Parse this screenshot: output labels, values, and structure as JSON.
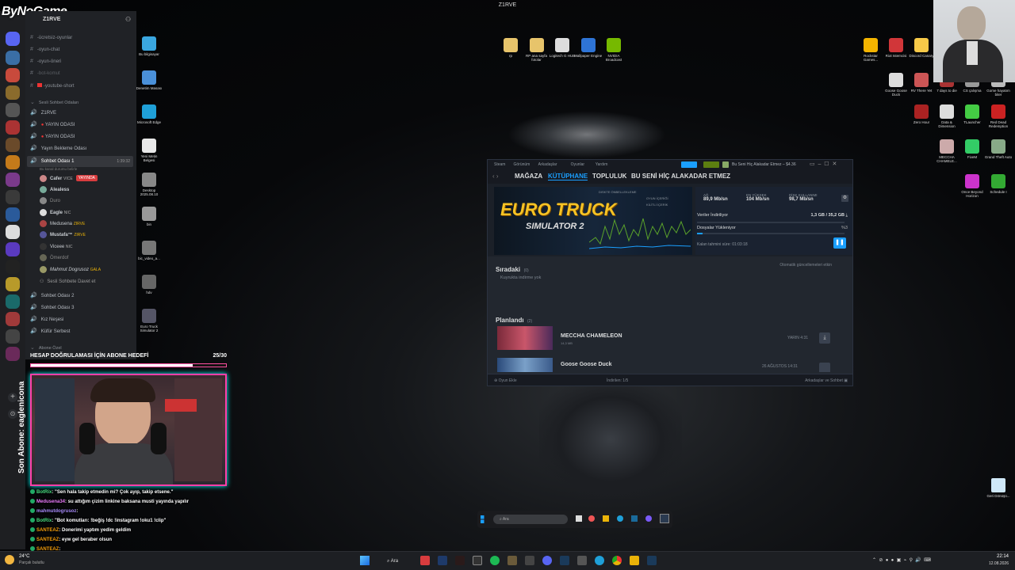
{
  "window": {
    "title": "Z1RVE"
  },
  "brand": {
    "logo": "ByNoGame"
  },
  "discord": {
    "server_name": "Z1RVE",
    "text_channels": [
      "-ücretsiz-oyunlar",
      "-oyun-chat",
      "-oyun-öneri",
      "-bot-komut",
      "-youtube-short"
    ],
    "voice_category": "Sesli Sohbet Odaları",
    "voice_channels": [
      "Z1RVE",
      "YAYIN ODASI",
      "YAYIN ODASI",
      "Yayın Bekleme Odası",
      "Sohbet Odası 1"
    ],
    "voice_topic": "Bu kanal durumu belirle",
    "voice_time": "1:39:32",
    "members": [
      {
        "name": "Cafer",
        "tag": "VICE",
        "live": "YAYINDA"
      },
      {
        "name": "Alealess",
        "tag": "",
        "live": ""
      },
      {
        "name": "Duro",
        "tag": "",
        "live": ""
      },
      {
        "name": "Eagle",
        "tag": "NIC",
        "live": ""
      },
      {
        "name": "Medusena",
        "tag": "ZIRVE",
        "live": ""
      },
      {
        "name": "Mustafa™",
        "tag": "ZIRVE",
        "live": ""
      },
      {
        "name": "Viceee",
        "tag": "NIC",
        "live": ""
      },
      {
        "name": "Ömerdof",
        "tag": "",
        "live": ""
      },
      {
        "name": "Mahmut Dogrusoz",
        "tag": "GALA",
        "live": ""
      }
    ],
    "invite_label": "Sesli Sohbete Davet et",
    "more_voice": [
      "Sohbet Odası 2",
      "Sohbet Odası 3",
      "Kız Neşesi",
      "Küfür Serbest"
    ],
    "subscriber_category": "Abone Özel",
    "subscriber_room": "Abone Sesli"
  },
  "stream": {
    "goal_label": "HESAP DOĞRULAMASI İÇİN ABONE HEDEFİ",
    "goal_count": "25/30",
    "goal_progress": 0.83,
    "vertical_text": "Son Abone: eaglenicona",
    "chat": [
      {
        "user": "BotRix",
        "text": ": \"Sen hala takip etmedin mi? Çok ayıp, takip etsene.\"",
        "color": "#4ade80"
      },
      {
        "user": "Medusena34",
        "text": ": su attığım çizim linkine baksana musti yayında yapılır",
        "color": "#e879f9"
      },
      {
        "user": "mahmutdogrusoz",
        "text": ":",
        "color": "#a78bfa"
      },
      {
        "user": "BotRix",
        "text": ": \"Bot komutları: !beğiş !dc !instagram !oku1 !clip\"",
        "color": "#4ade80"
      },
      {
        "user": "SANTEAZ",
        "text": ": Donerimi yaptım yedim geldim",
        "color": "#f59e0b"
      },
      {
        "user": "SANTEAZ",
        "text": ": eyw gel beraber olsun",
        "color": "#f59e0b"
      },
      {
        "user": "SANTEAZ",
        "text": ":",
        "color": "#f59e0b"
      },
      {
        "user": "SANTEAZ",
        "text": ": onun saati geçti",
        "color": "#f59e0b"
      }
    ]
  },
  "desktop_left": [
    {
      "label": "Bu bilgisayar",
      "color": "#3aa7e0"
    },
    {
      "label": "Denetim Masası",
      "color": "#4a90d9"
    },
    {
      "label": "Microsoft Edge",
      "color": "#1fa0d8"
    },
    {
      "label": "Yeni Metin Belgesi",
      "color": "#e8e8e8"
    },
    {
      "label": "Desktop 2025.08.10",
      "color": "#888"
    },
    {
      "label": "bin",
      "color": "#999"
    },
    {
      "label": "bic_video_a...",
      "color": "#777"
    },
    {
      "label": "hdv",
      "color": "#666"
    },
    {
      "label": "Euro Truck Simulator 2",
      "color": "#556"
    }
  ],
  "desktop_top": [
    {
      "label": "rp",
      "color": "#e7c46b"
    },
    {
      "label": "RP ana sayfa fotolar",
      "color": "#e7c46b"
    },
    {
      "label": "Logitech G HUB",
      "color": "#ddd"
    },
    {
      "label": "Wallpaper Engine",
      "color": "#2e74d6"
    },
    {
      "label": "NVIDIA Broadcast",
      "color": "#76b900"
    }
  ],
  "desktop_right": [
    {
      "label": "Rockstar Games...",
      "color": "#f4b400"
    },
    {
      "label": "Riot Istemcisi",
      "color": "#d13639"
    },
    {
      "label": "Discord Canary",
      "color": "#f7c948"
    },
    {
      "label": "Goose Goose Duck",
      "color": "#ddd"
    },
    {
      "label": "RV There Yet",
      "color": "#c55"
    },
    {
      "label": "7 days to die",
      "color": "#a33"
    },
    {
      "label": "CS çalışma",
      "color": "#999"
    },
    {
      "label": "Gome hayatım biter",
      "color": "#bbb"
    },
    {
      "label": "Zero Hour",
      "color": "#a22"
    },
    {
      "label": "Data & Dimension",
      "color": "#ddd"
    },
    {
      "label": "TLauncher",
      "color": "#4c4"
    },
    {
      "label": "Red Dead Redemption",
      "color": "#c22"
    },
    {
      "label": "MECCHA CHAMELE...",
      "color": "#caa"
    },
    {
      "label": "FiveM",
      "color": "#3c6"
    },
    {
      "label": "Grand Theft Auto",
      "color": "#8a8"
    },
    {
      "label": "Once Beyond Horizon",
      "color": "#c3c"
    },
    {
      "label": "Schedule I",
      "color": "#3a3"
    }
  ],
  "recycle_bin": "Geri Dönüşü...",
  "steam": {
    "menu": [
      "Steam",
      "Görünüm",
      "Arkadaşlar",
      "Oyunlar",
      "Yardım"
    ],
    "nav": [
      "MAĞAZA",
      "KÜTÜPHANE",
      "TOPLULUK",
      "BU SENİ HİÇ ALAKADAR ETMEZ"
    ],
    "user_label": "Bu Seni Hiç Alakadar Etmez",
    "wallet": "$4.36",
    "banner_line1": "EURO TRUCK",
    "banner_line2": "SIMULATOR 2",
    "graph_legend": [
      "DISKTE ÖNBELLEKLEME",
      "OYUN İÇERİĞİ",
      "KİLİTLİ İÇERİK"
    ],
    "stats": [
      {
        "label": "AĞ",
        "value": "89,9 Mb/sn"
      },
      {
        "label": "EN YÜKSEK",
        "value": "104 Mb/sn"
      },
      {
        "label": "DİSK KULLANIMI",
        "value": "98,7 Mb/sn"
      }
    ],
    "downloaded_label": "Veriler İndiriliyor",
    "downloaded_value": "1,3 GB / 35,2 GB",
    "files_label": "Dosyalar Yükleniyor",
    "files_percent": "%3",
    "download_progress": 0.04,
    "time_left": "Kalan tahmini süre: 01:03:18",
    "queue_title": "Sıradaki",
    "queue_count": "(0)",
    "queue_hint": "Otomatik güncellemeleri etkin",
    "queue_empty": "Kuyrukta indirme yok",
    "planned_title": "Planlandı",
    "planned_count": "(2)",
    "planned": [
      {
        "name": "MECCHA CHAMELEON",
        "size": "14,3 MB",
        "when": "YARIN 4:31"
      },
      {
        "name": "Goose Goose Duck",
        "size": "",
        "when": "26 AĞUSTOS 14:31"
      }
    ],
    "footer_left": "Oyun Ekle",
    "footer_mid": "İndirilen: 1/5",
    "footer_right": "Arkadaşlar ve Sohbet"
  },
  "steam_taskbar": {
    "search_placeholder": "Ara"
  },
  "taskbar": {
    "search": "Ara",
    "weather_temp": "24°C",
    "weather_desc": "Parçalı bulutlu",
    "time": "22:14",
    "date": "12.08.2026"
  }
}
